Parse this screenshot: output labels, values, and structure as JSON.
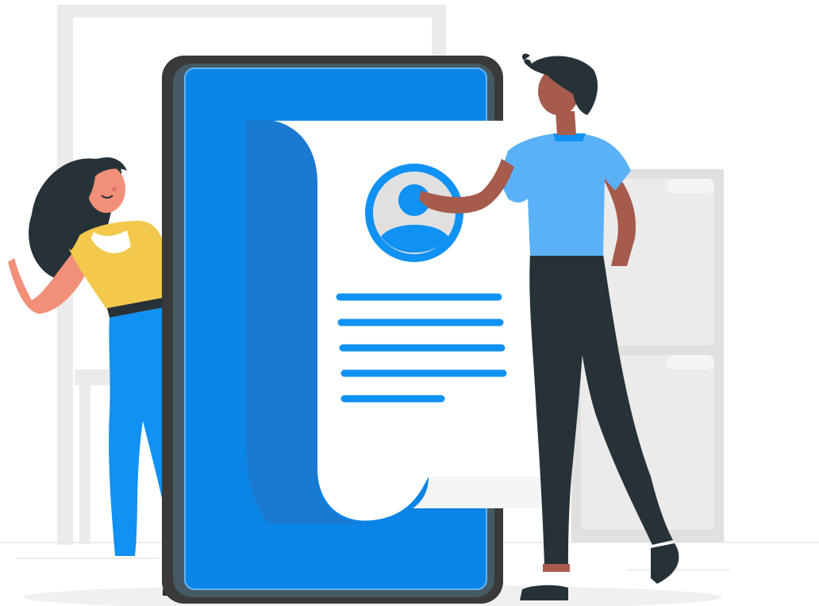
{
  "scene": {
    "colors": {
      "primary_blue": "#0A84E6",
      "phone_frame": "#3A3A3A",
      "paper_white": "#FFFFFF",
      "paper_shadow": "#1A79D0",
      "avatar_blue": "#1091F4",
      "text_line_blue": "#1091F4",
      "man_shirt": "#5AB1F7",
      "man_pants": "#263238",
      "man_skin": "#A65B4C",
      "man_hair": "#263238",
      "woman_top": "#F2C94C",
      "woman_jeans": "#1091F4",
      "woman_hair": "#263238",
      "woman_skin": "#F28F79",
      "background_gray": "#EBEBEB",
      "floor_shadow": "#F0F0F0"
    },
    "icons": [
      "user-avatar-icon"
    ],
    "document_line_count": 5
  }
}
